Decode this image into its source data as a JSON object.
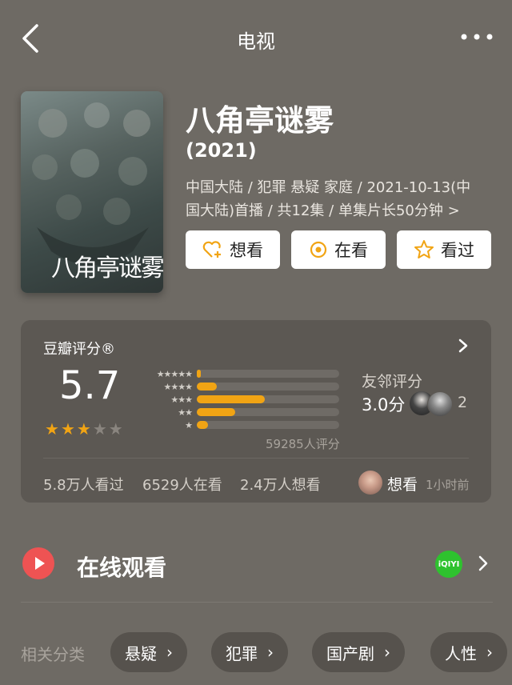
{
  "header": {
    "title": "电视",
    "back_icon": "chevron-left-icon",
    "more_icon": "more-dots-icon"
  },
  "movie": {
    "title": "八角亭谜雾",
    "poster_text": "八角亭谜雾",
    "year": "(2021)",
    "meta": "中国大陆 / 犯罪 悬疑 家庭 / 2021-10-13(中国大陆)首播 / 共12集 / 单集片长50分钟 >"
  },
  "actions": [
    {
      "label": "想看",
      "icon": "heart-plus-icon"
    },
    {
      "label": "在看",
      "icon": "target-icon"
    },
    {
      "label": "看过",
      "icon": "star-outline-icon"
    }
  ],
  "rating": {
    "title": "豆瓣评分®",
    "score": "5.7",
    "stars": 3,
    "distribution_percent": [
      3,
      14,
      48,
      27,
      8
    ],
    "count_text": "59285人评分",
    "friends_label": "友邻评分",
    "friends_score": "3.0分",
    "friends_count": "2",
    "stats": {
      "seen": "5.8万人看过",
      "watching": "6529人在看",
      "wish": "2.4万人想看"
    },
    "recent": {
      "action": "想看",
      "time": "1小时前"
    }
  },
  "watch": {
    "label": "在线观看",
    "provider": "iQIYI"
  },
  "categories": {
    "label": "相关分类",
    "items": [
      "悬疑",
      "犯罪",
      "国产剧",
      "人性"
    ]
  },
  "colors": {
    "accent": "#f1a414",
    "card": "#5c5853",
    "play": "#ee5353",
    "iqiyi": "#2ec22e"
  }
}
